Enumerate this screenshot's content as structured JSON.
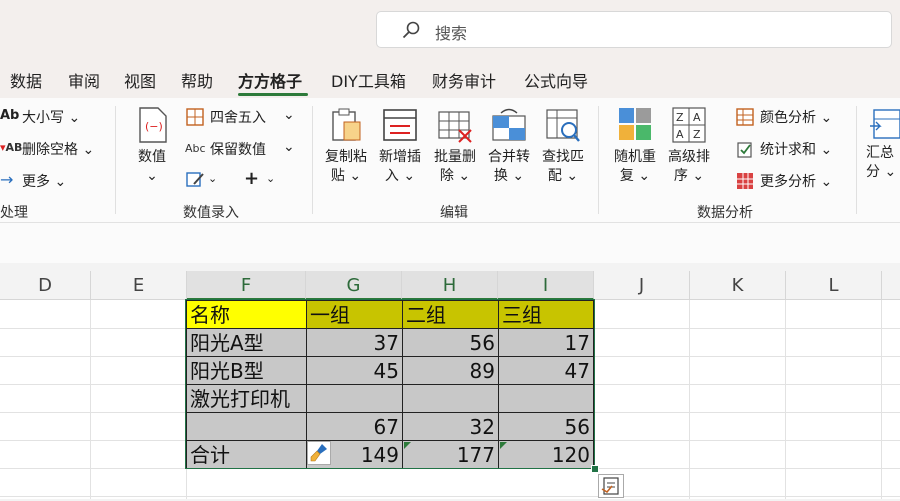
{
  "search": {
    "placeholder": "搜索"
  },
  "tabs": [
    "数据",
    "审阅",
    "视图",
    "帮助",
    "方方格子",
    "DIY工具箱",
    "财务审计",
    "公式向导"
  ],
  "active_tab": "方方格子",
  "ribbon": {
    "group_text": {
      "items": [
        "大小写 ⌄",
        "删除空格 ⌄",
        "更多 ⌄"
      ],
      "label": "处理"
    },
    "group_values": {
      "big_button": [
        "数值",
        "⌄"
      ],
      "items": [
        "四舍五入",
        "保留数值",
        "+"
      ],
      "label": "数值录入"
    },
    "group_edit": {
      "buttons": [
        [
          "复制粘",
          "贴 ⌄"
        ],
        [
          "新增插",
          "入 ⌄"
        ],
        [
          "批量删",
          "除 ⌄"
        ],
        [
          "合并转",
          "换 ⌄"
        ],
        [
          "查找匹",
          "配 ⌄"
        ]
      ],
      "label": "编辑"
    },
    "group_analysis": {
      "buttons": [
        [
          "随机重",
          "复 ⌄"
        ],
        [
          "高级排",
          "序 ⌄"
        ]
      ],
      "items": [
        "颜色分析 ⌄",
        "统计求和 ⌄",
        "更多分析 ⌄"
      ],
      "label": "数据分析"
    },
    "group_summary": {
      "button": [
        "汇总",
        "分 ⌄"
      ]
    }
  },
  "sheet": {
    "columns": [
      "D",
      "E",
      "F",
      "G",
      "H",
      "I",
      "J",
      "K",
      "L"
    ],
    "selected_columns": [
      "F",
      "G",
      "H",
      "I"
    ],
    "table": {
      "header": [
        "名称",
        "一组",
        "二组",
        "三组"
      ],
      "rows": [
        [
          "阳光A型",
          "37",
          "56",
          "17"
        ],
        [
          "阳光B型",
          "45",
          "89",
          "47"
        ],
        [
          "激光打印机",
          "",
          "",
          ""
        ],
        [
          "",
          "67",
          "32",
          "56"
        ],
        [
          "合计",
          "149",
          "177",
          "120"
        ]
      ]
    }
  },
  "colors": {
    "accent": "#2d7a3a",
    "header_name": "#ffff00",
    "header_group": "#c8c400",
    "data_fill": "#c8c8c8"
  }
}
